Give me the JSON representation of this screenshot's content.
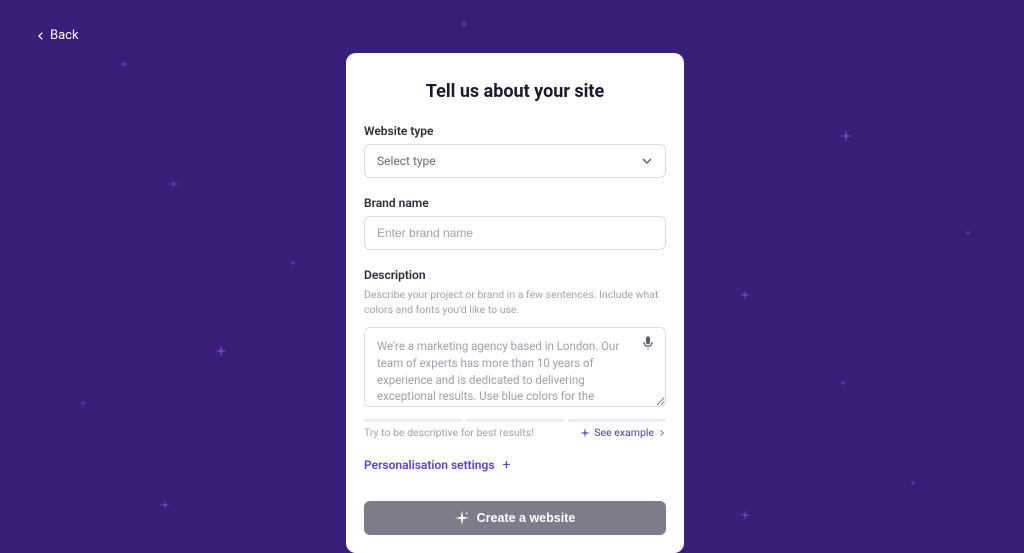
{
  "back": {
    "label": "Back"
  },
  "card": {
    "title": "Tell us about your site",
    "websiteType": {
      "label": "Website type",
      "placeholder": "Select type"
    },
    "brandName": {
      "label": "Brand name",
      "placeholder": "Enter brand name"
    },
    "description": {
      "label": "Description",
      "hint": "Describe your project or brand in a few sentences. Include what colors and fonts you'd like to use.",
      "placeholder": "We're a marketing agency based in London. Our team of experts has more than 10 years of experience and is dedicated to delivering exceptional results. Use blue colors for the website..."
    },
    "tip": "Try to be descriptive for best results!",
    "seeExample": "See example",
    "personalisation": "Personalisation settings",
    "createBtn": "Create a website"
  }
}
